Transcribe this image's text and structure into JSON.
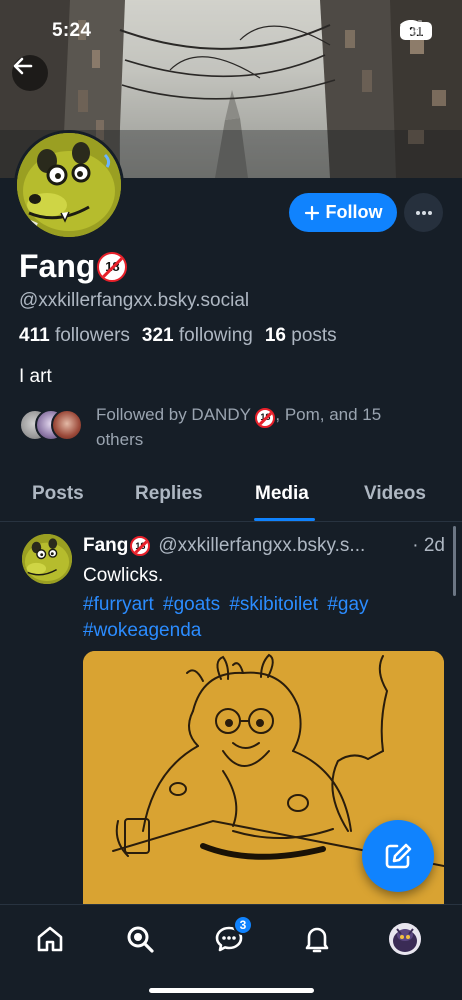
{
  "status_bar": {
    "time": "5:24",
    "battery": "81",
    "icons": [
      "cellular-signal-icon",
      "wifi-icon",
      "battery-icon"
    ]
  },
  "profile": {
    "display_name": "Fang",
    "age_badge": "18",
    "handle": "@xxkillerfangxx.bsky.social",
    "followers_count": "411",
    "followers_label": "followers",
    "following_count": "321",
    "following_label": "following",
    "posts_count": "16",
    "posts_label": "posts",
    "bio": "I art",
    "followed_by_prefix": "Followed by DANDY",
    "followed_by_suffix": ", Pom, and 15 others"
  },
  "actions": {
    "follow_label": "Follow"
  },
  "tabs": [
    {
      "label": "Posts"
    },
    {
      "label": "Replies"
    },
    {
      "label": "Media"
    },
    {
      "label": "Videos"
    }
  ],
  "active_tab": "Media",
  "post": {
    "author": "Fang",
    "handle": "@xxkillerfangxx.bsky.s...",
    "time": "· 2d",
    "text": "Cowlicks.",
    "hashtags": [
      "#furryart",
      "#goats",
      "#skibitoilet",
      "#gay",
      "#wokeagenda"
    ]
  },
  "nav": {
    "chat_badge": "3"
  },
  "colors": {
    "background": "#161e27",
    "accent": "#1083fe",
    "hashtag": "#2b8cff",
    "muted_text": "#aeb7c2"
  }
}
